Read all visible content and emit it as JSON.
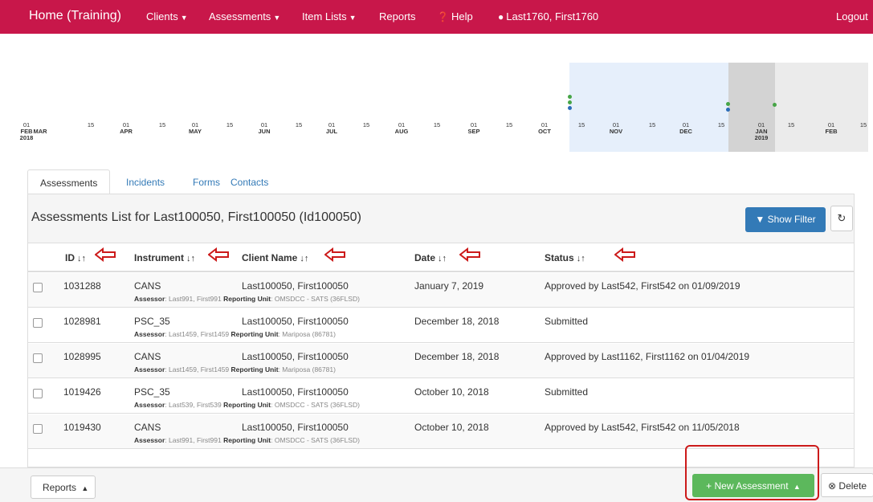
{
  "navbar": {
    "brand": "Home (Training)",
    "items": [
      {
        "label": "Clients",
        "dropdown": true
      },
      {
        "label": "Assessments",
        "dropdown": true
      },
      {
        "label": "Item Lists",
        "dropdown": true
      },
      {
        "label": "Reports",
        "dropdown": false
      },
      {
        "label": "Help",
        "icon": "question-circle-icon"
      },
      {
        "label": "Last1760, First1760",
        "icon": "user-icon"
      }
    ],
    "logout": "Logout",
    "color": "#c8174a"
  },
  "timeline": {
    "labels": [
      {
        "day": "01",
        "month": "FEB",
        "year": "2018"
      },
      {
        "day": "",
        "month": "MAR"
      },
      {
        "day": "15",
        "month": ""
      },
      {
        "day": "01",
        "month": "APR"
      },
      {
        "day": "15",
        "month": ""
      },
      {
        "day": "01",
        "month": "MAY"
      },
      {
        "day": "15",
        "month": ""
      },
      {
        "day": "01",
        "month": "JUN"
      },
      {
        "day": "15",
        "month": ""
      },
      {
        "day": "01",
        "month": "JUL"
      },
      {
        "day": "15",
        "month": ""
      },
      {
        "day": "01",
        "month": "AUG"
      },
      {
        "day": "15",
        "month": ""
      },
      {
        "day": "01",
        "month": "SEP"
      },
      {
        "day": "15",
        "month": ""
      },
      {
        "day": "01",
        "month": "OCT"
      },
      {
        "day": "15",
        "month": ""
      },
      {
        "day": "01",
        "month": "NOV"
      },
      {
        "day": "15",
        "month": ""
      },
      {
        "day": "01",
        "month": "DEC"
      },
      {
        "day": "15",
        "month": ""
      },
      {
        "day": "01",
        "month": "JAN",
        "year": "2019"
      },
      {
        "day": "15",
        "month": ""
      },
      {
        "day": "01",
        "month": "FEB"
      },
      {
        "day": "15",
        "month": ""
      }
    ]
  },
  "tabs": [
    "Assessments",
    "Incidents",
    "Forms",
    "Contacts"
  ],
  "panel": {
    "title": "Assessments List for Last100050, First100050 (Id100050)",
    "show_filter": "Show Filter"
  },
  "columns": [
    "ID",
    "Instrument",
    "Client Name",
    "Date",
    "Status"
  ],
  "rows": [
    {
      "id": "1031288",
      "instrument": "CANS",
      "client": "Last100050, First100050",
      "date": "January 7, 2019",
      "status": "Approved by Last542, First542 on 01/09/2019",
      "assessor_label": "Assessor",
      "assessor": "Last991, First991",
      "unit_label": "Reporting Unit",
      "unit": "OMSDCC - SATS (36FLSD)"
    },
    {
      "id": "1028981",
      "instrument": "PSC_35",
      "client": "Last100050, First100050",
      "date": "December 18, 2018",
      "status": "Submitted",
      "assessor_label": "Assessor",
      "assessor": "Last1459, First1459",
      "unit_label": "Reporting Unit",
      "unit": "Mariposa (86781)"
    },
    {
      "id": "1028995",
      "instrument": "CANS",
      "client": "Last100050, First100050",
      "date": "December 18, 2018",
      "status": "Approved by Last1162, First1162 on 01/04/2019",
      "assessor_label": "Assessor",
      "assessor": "Last1459, First1459",
      "unit_label": "Reporting Unit",
      "unit": "Mariposa (86781)"
    },
    {
      "id": "1019426",
      "instrument": "PSC_35",
      "client": "Last100050, First100050",
      "date": "October 10, 2018",
      "status": "Submitted",
      "assessor_label": "Assessor",
      "assessor": "Last539, First539",
      "unit_label": "Reporting Unit",
      "unit": "OMSDCC - SATS (36FLSD)"
    },
    {
      "id": "1019430",
      "instrument": "CANS",
      "client": "Last100050, First100050",
      "date": "October 10, 2018",
      "status": "Approved by Last542, First542 on 11/05/2018",
      "assessor_label": "Assessor",
      "assessor": "Last991, First991",
      "unit_label": "Reporting Unit",
      "unit": "OMSDCC - SATS (36FLSD)"
    }
  ],
  "footer": {
    "reports": "Reports",
    "new_assessment": "New Assessment",
    "delete": "Delete"
  },
  "colors": {
    "primary": "#337ab7",
    "success": "#5cb85c",
    "annotation": "#cc1a1a"
  }
}
